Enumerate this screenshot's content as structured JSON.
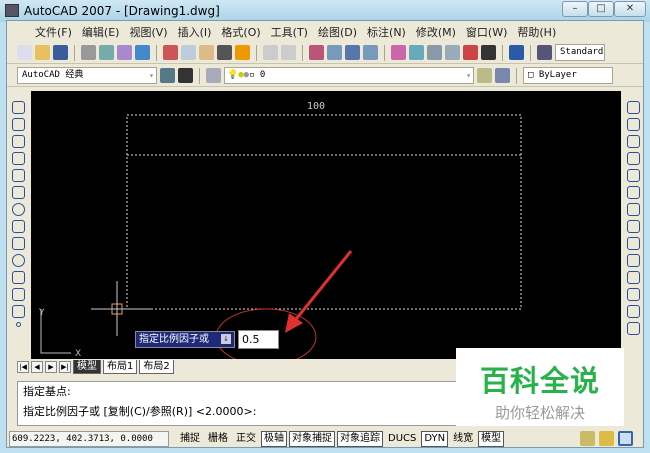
{
  "window": {
    "title": "AutoCAD 2007 - [Drawing1.dwg]"
  },
  "menu": [
    "文件(F)",
    "编辑(E)",
    "视图(V)",
    "插入(I)",
    "格式(O)",
    "工具(T)",
    "绘图(D)",
    "标注(N)",
    "修改(M)",
    "窗口(W)",
    "帮助(H)"
  ],
  "toolbar": {
    "text_style": "Standard",
    "workspace": "AutoCAD 经典",
    "layer": "0",
    "color": "ByLayer"
  },
  "drawing": {
    "dimension_text": "100",
    "ucs_x": "X",
    "ucs_y": "Y"
  },
  "dynamic_input": {
    "prompt": "指定比例因子或",
    "value": "0.5"
  },
  "tabs": [
    "模型",
    "布局1",
    "布局2"
  ],
  "command": {
    "lines": [
      "指定基点:",
      "指定比例因子或 [复制(C)/参照(R)] <2.0000>:"
    ]
  },
  "status": {
    "coords": "609.2223, 402.3713, 0.0000",
    "buttons": [
      {
        "label": "捕捉",
        "on": false
      },
      {
        "label": "栅格",
        "on": false
      },
      {
        "label": "正交",
        "on": false
      },
      {
        "label": "极轴",
        "on": true
      },
      {
        "label": "对象捕捉",
        "on": true
      },
      {
        "label": "对象追踪",
        "on": true
      },
      {
        "label": "DUCS",
        "on": false
      },
      {
        "label": "DYN",
        "on": true
      },
      {
        "label": "线宽",
        "on": false
      },
      {
        "label": "模型",
        "on": true
      }
    ]
  },
  "watermark": {
    "title": "百科全说",
    "subtitle": "助你轻松解决"
  },
  "colors": {
    "canvas": "#000000",
    "accent": "#e03030",
    "watermark": "#27b34a"
  }
}
